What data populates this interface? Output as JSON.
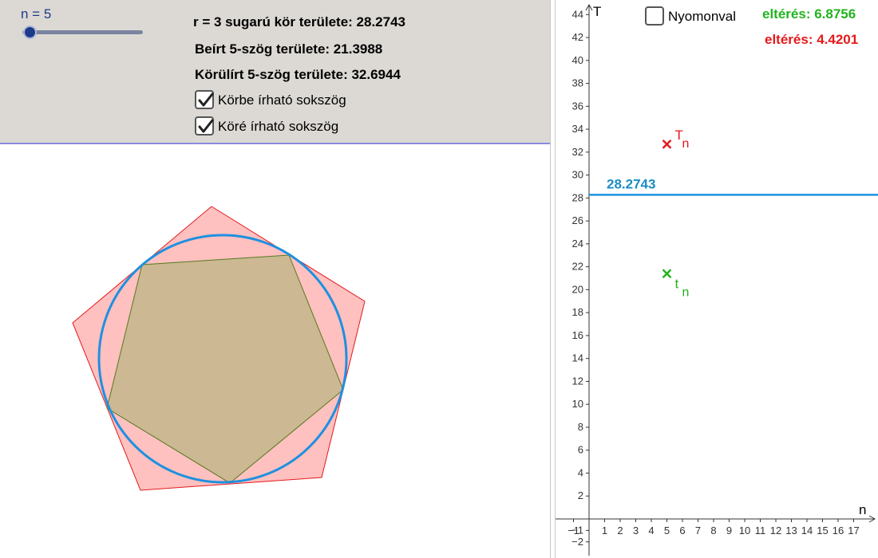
{
  "slider": {
    "label": "n = 5",
    "value": 5,
    "min": 3,
    "max": 50
  },
  "info": {
    "circle_area": "r = 3 sugarú kör területe: 28.2743",
    "inscribed_area": "Beírt 5-szög területe: 21.3988",
    "circumscribed_area": "Körülírt 5-szög területe: 32.6944"
  },
  "checkboxes": {
    "inscribed": {
      "label": "Körbe írható sokszög",
      "checked": true
    },
    "circumscribed": {
      "label": "Köré írható sokszög",
      "checked": true
    },
    "trace": {
      "label": "Nyomonval",
      "checked": false
    }
  },
  "deviations": {
    "green": "eltérés: 6.8756",
    "red": "eltérés: 4.4201"
  },
  "graph": {
    "x_axis_label": "n",
    "y_axis_label": "T",
    "x_ticks": [
      "−1",
      "1",
      "2",
      "3",
      "4",
      "5",
      "6",
      "7",
      "8",
      "9",
      "10",
      "11",
      "12",
      "13",
      "14",
      "15",
      "16",
      "17"
    ],
    "y_ticks": [
      "−2",
      "−1",
      "2",
      "4",
      "6",
      "8",
      "10",
      "12",
      "14",
      "16",
      "18",
      "20",
      "22",
      "24",
      "26",
      "28",
      "30",
      "32",
      "34",
      "36",
      "38",
      "40",
      "42",
      "44"
    ],
    "circle_line_value": 28.2743,
    "circle_line_label": "28.2743",
    "points": [
      {
        "label": "T",
        "sub": "n",
        "n": 5,
        "T": 32.6944,
        "color": "#e31a1c"
      },
      {
        "label": "t",
        "sub": "n",
        "n": 5,
        "T": 21.3988,
        "color": "#22b31e"
      }
    ]
  },
  "colors": {
    "panel_bg": "#dcd9d4",
    "circle": "#1e90e0",
    "outer_polygon_fill": "#ffc0c0",
    "outer_polygon_stroke": "#e31a1c",
    "inner_polygon_fill": "#ccb892",
    "inner_polygon_stroke": "#557a1d",
    "green": "#22b31e",
    "red": "#e31a1c"
  }
}
